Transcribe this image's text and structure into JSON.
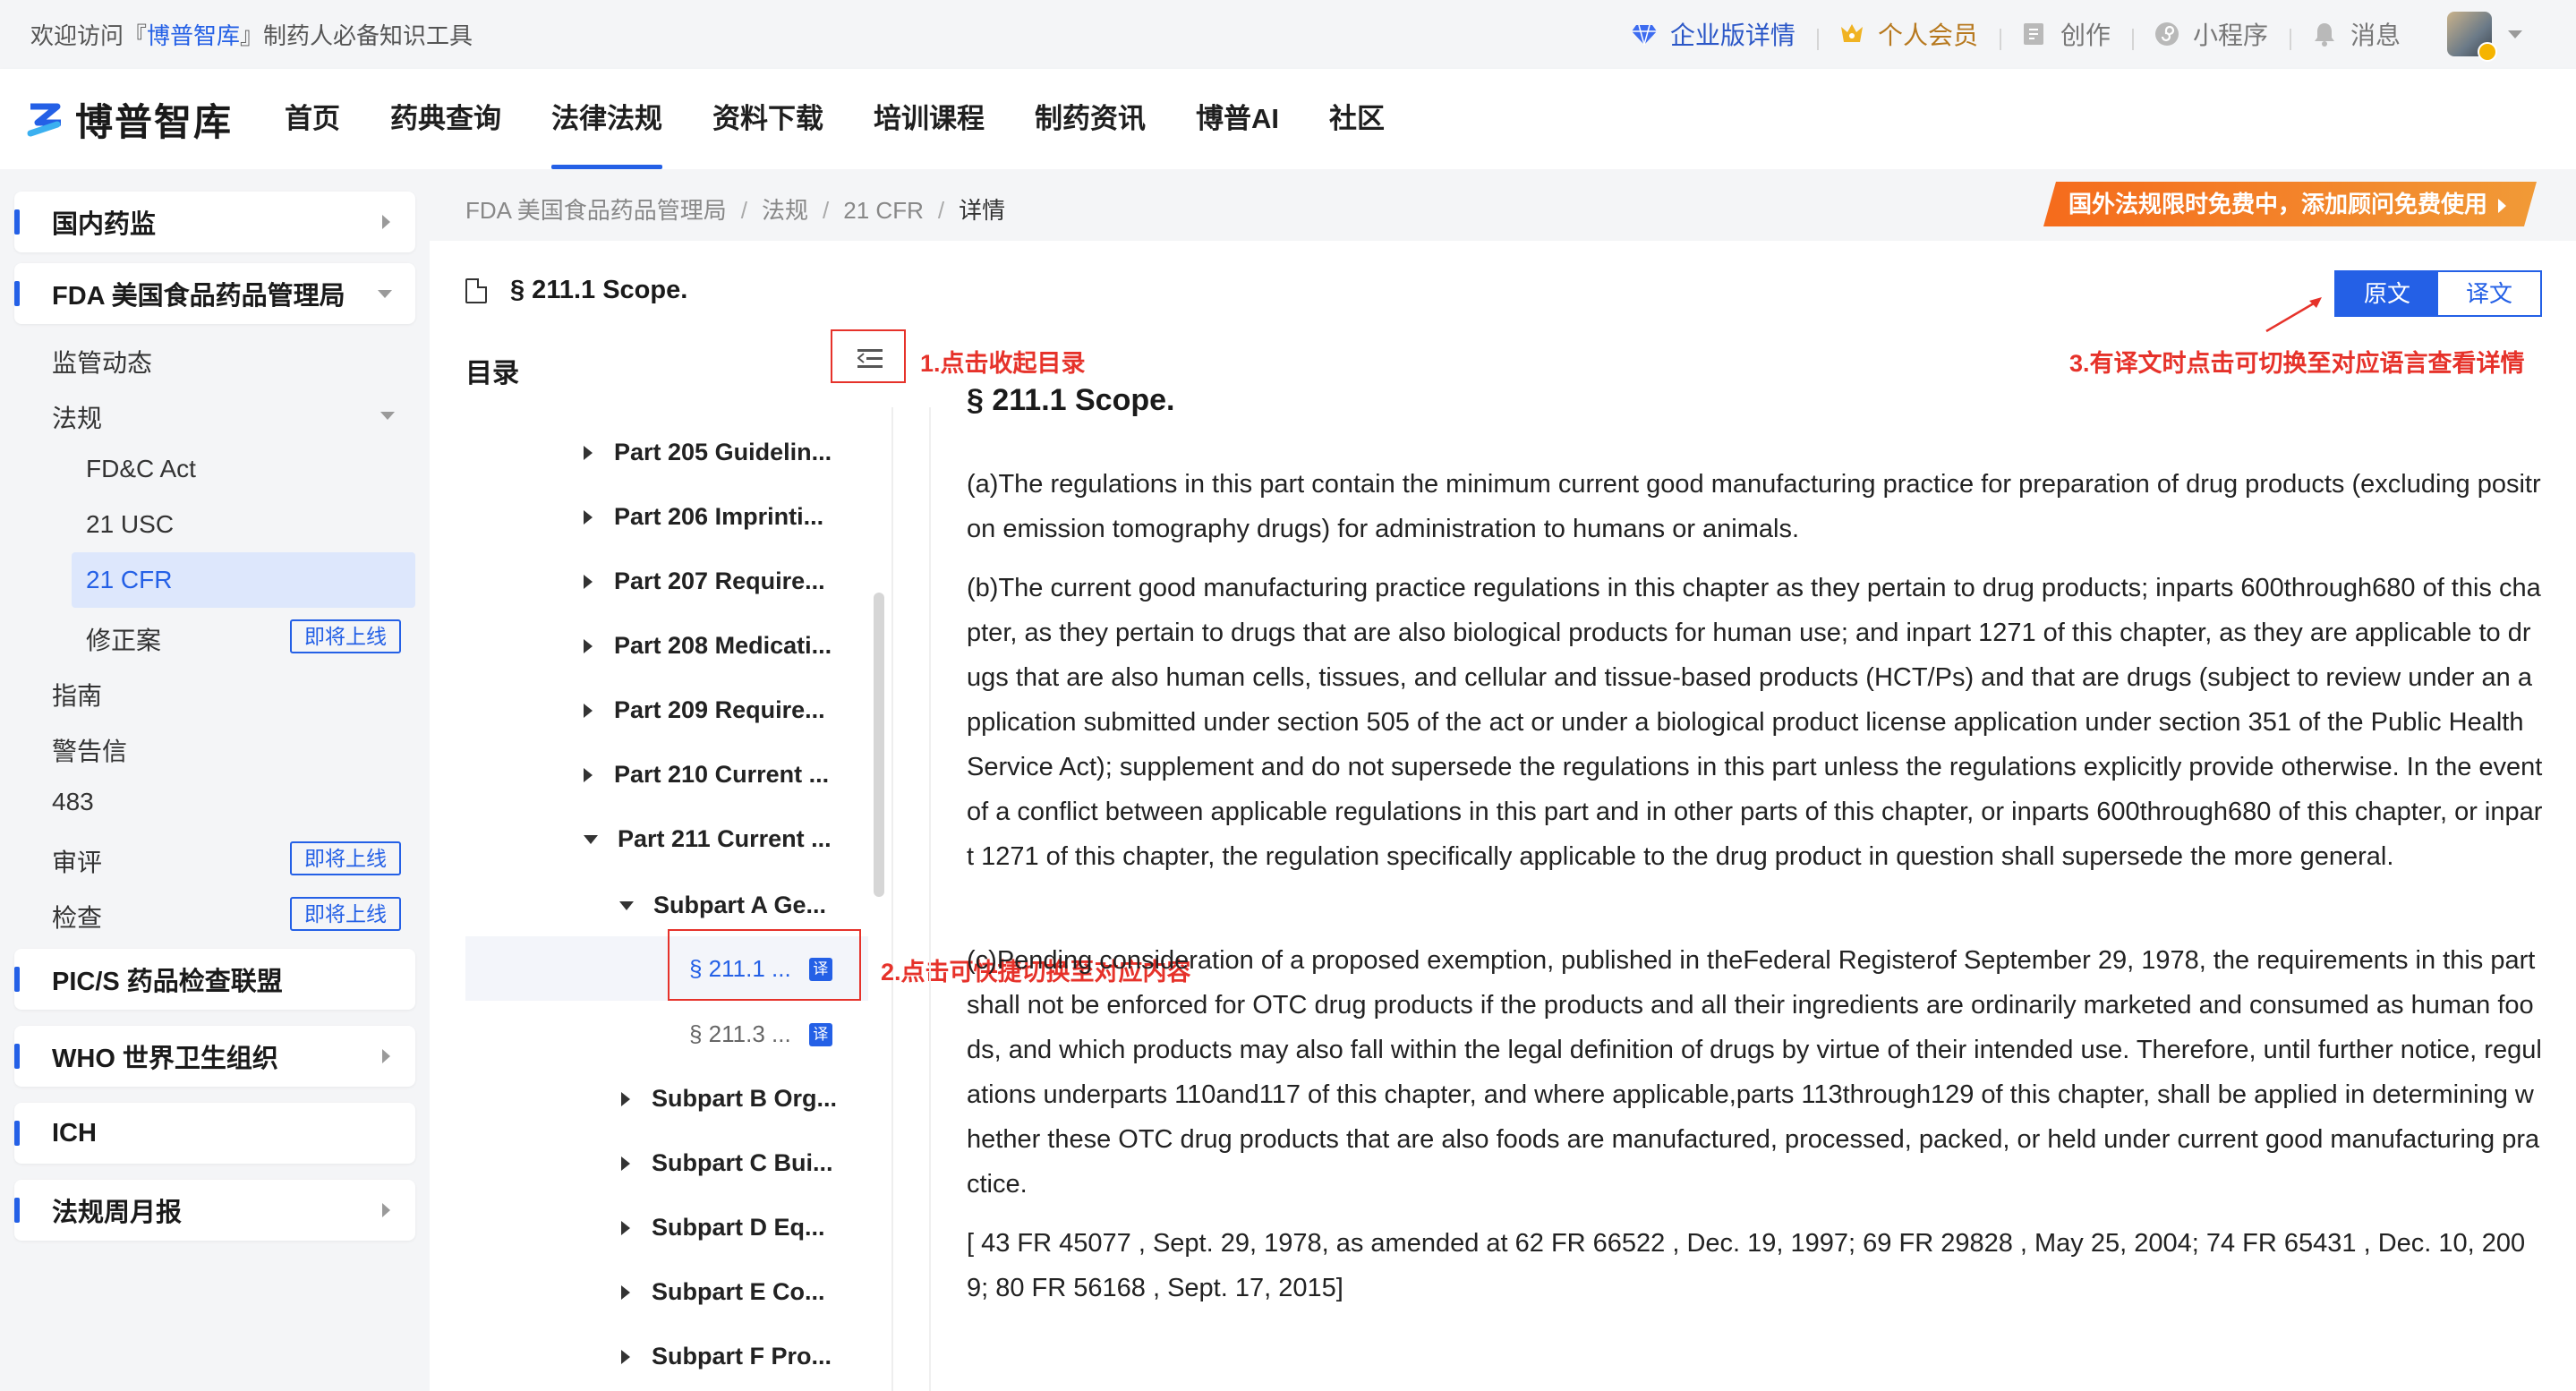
{
  "topbar": {
    "welcome_prefix": "欢迎访问『",
    "welcome_brand": "博普智库",
    "welcome_suffix": "』制药人必备知识工具",
    "enterprise": "企业版详情",
    "member": "个人会员",
    "create": "创作",
    "miniprogram": "小程序",
    "messages": "消息"
  },
  "nav": {
    "logo": "博普智库",
    "items": [
      "首页",
      "药典查询",
      "法律法规",
      "资料下载",
      "培训课程",
      "制药资讯",
      "博普AI",
      "社区"
    ],
    "active_index": 2
  },
  "sidebar": {
    "domestic": "国内药监",
    "fda": "FDA 美国食品药品管理局",
    "fda_children": {
      "news": "监管动态",
      "law": "法规",
      "fdc": "FD&C Act",
      "usc": "21 USC",
      "cfr": "21 CFR",
      "amend": "修正案",
      "guide": "指南",
      "warning": "警告信",
      "n483": "483",
      "review": "审评",
      "inspect": "检查",
      "soon": "即将上线"
    },
    "pics": "PIC/S 药品检查联盟",
    "who": "WHO 世界卫生组织",
    "ich": "ICH",
    "weekly": "法规周月报"
  },
  "breadcrumb": {
    "items": [
      "FDA 美国食品药品管理局",
      "法规",
      "21 CFR"
    ],
    "current": "详情"
  },
  "promo": "国外法规限时免费中，添加顾问免费使用",
  "doc": {
    "title": "§ 211.1 Scope.",
    "lang_original": "原文",
    "lang_translated": "译文"
  },
  "toc": {
    "title": "目录",
    "parts": [
      "Part 205 Guidelin...",
      "Part 206 Imprinti...",
      "Part 207 Require...",
      "Part 208 Medicati...",
      "Part 209 Require...",
      "Part 210 Current ...",
      "Part 211 Current ..."
    ],
    "subpart_a": "Subpart A Ge...",
    "leaf_1": "§ 211.1 ...",
    "leaf_2": "§ 211.3 ...",
    "subparts": [
      "Subpart B Org...",
      "Subpart C Bui...",
      "Subpart D Eq...",
      "Subpart E Co...",
      "Subpart F Pro..."
    ],
    "translate_tag": "译"
  },
  "annotations": {
    "collapse": "1.点击收起目录",
    "switch_content": "2.点击可快捷切换至对应内容",
    "switch_lang": "3.有译文时点击可切换至对应语言查看详情"
  },
  "article": {
    "heading": "§ 211.1 Scope.",
    "p_a": "(a)The regulations in this part contain the minimum current good manufacturing practice for preparation of drug products (excluding positron emission tomography drugs) for administration to humans or animals.",
    "p_b": "(b)The current good manufacturing practice regulations in this chapter as they pertain to drug products; inparts 600through680 of this chapter, as they pertain to drugs that are also biological products for human use; and inpart 1271 of this chapter, as they are applicable to drugs that are also human cells, tissues, and cellular and tissue-based products (HCT/Ps) and that are drugs (subject to review under an application submitted under section 505 of the act or under a biological product license application under section 351 of the Public Health Service Act); supplement and do not supersede the regulations in this part unless the regulations explicitly provide otherwise. In the event of a conflict between applicable regulations in this part and in other parts of this chapter, or inparts 600through680 of this chapter, or inpart 1271 of this chapter, the regulation specifically applicable to the drug product in question shall supersede the more general.",
    "p_c": "(c)Pending consideration of a proposed exemption, published in theFederal Registerof September 29, 1978, the requirements in this part shall not be enforced for OTC drug products if the products and all their ingredients are ordinarily marketed and consumed as human foods, and which products may also fall within the legal definition of drugs by virtue of their intended use. Therefore, until further notice, regulations underparts 110and117 of this chapter, and where applicable,parts 113through129 of this chapter, shall be applied in determining whether these OTC drug products that are also foods are manufactured, processed, packed, or held under current good manufacturing practice.",
    "citation": "[ 43 FR 45077 , Sept. 29, 1978, as amended at 62 FR 66522 , Dec. 19, 1997; 69 FR 29828 , May 25, 2004; 74 FR 65431 , Dec. 10, 2009; 80 FR 56168 , Sept. 17, 2015]"
  },
  "colors": {
    "accent": "#2460e6",
    "annotation": "#e6322a",
    "promo": "#f56b1c"
  }
}
